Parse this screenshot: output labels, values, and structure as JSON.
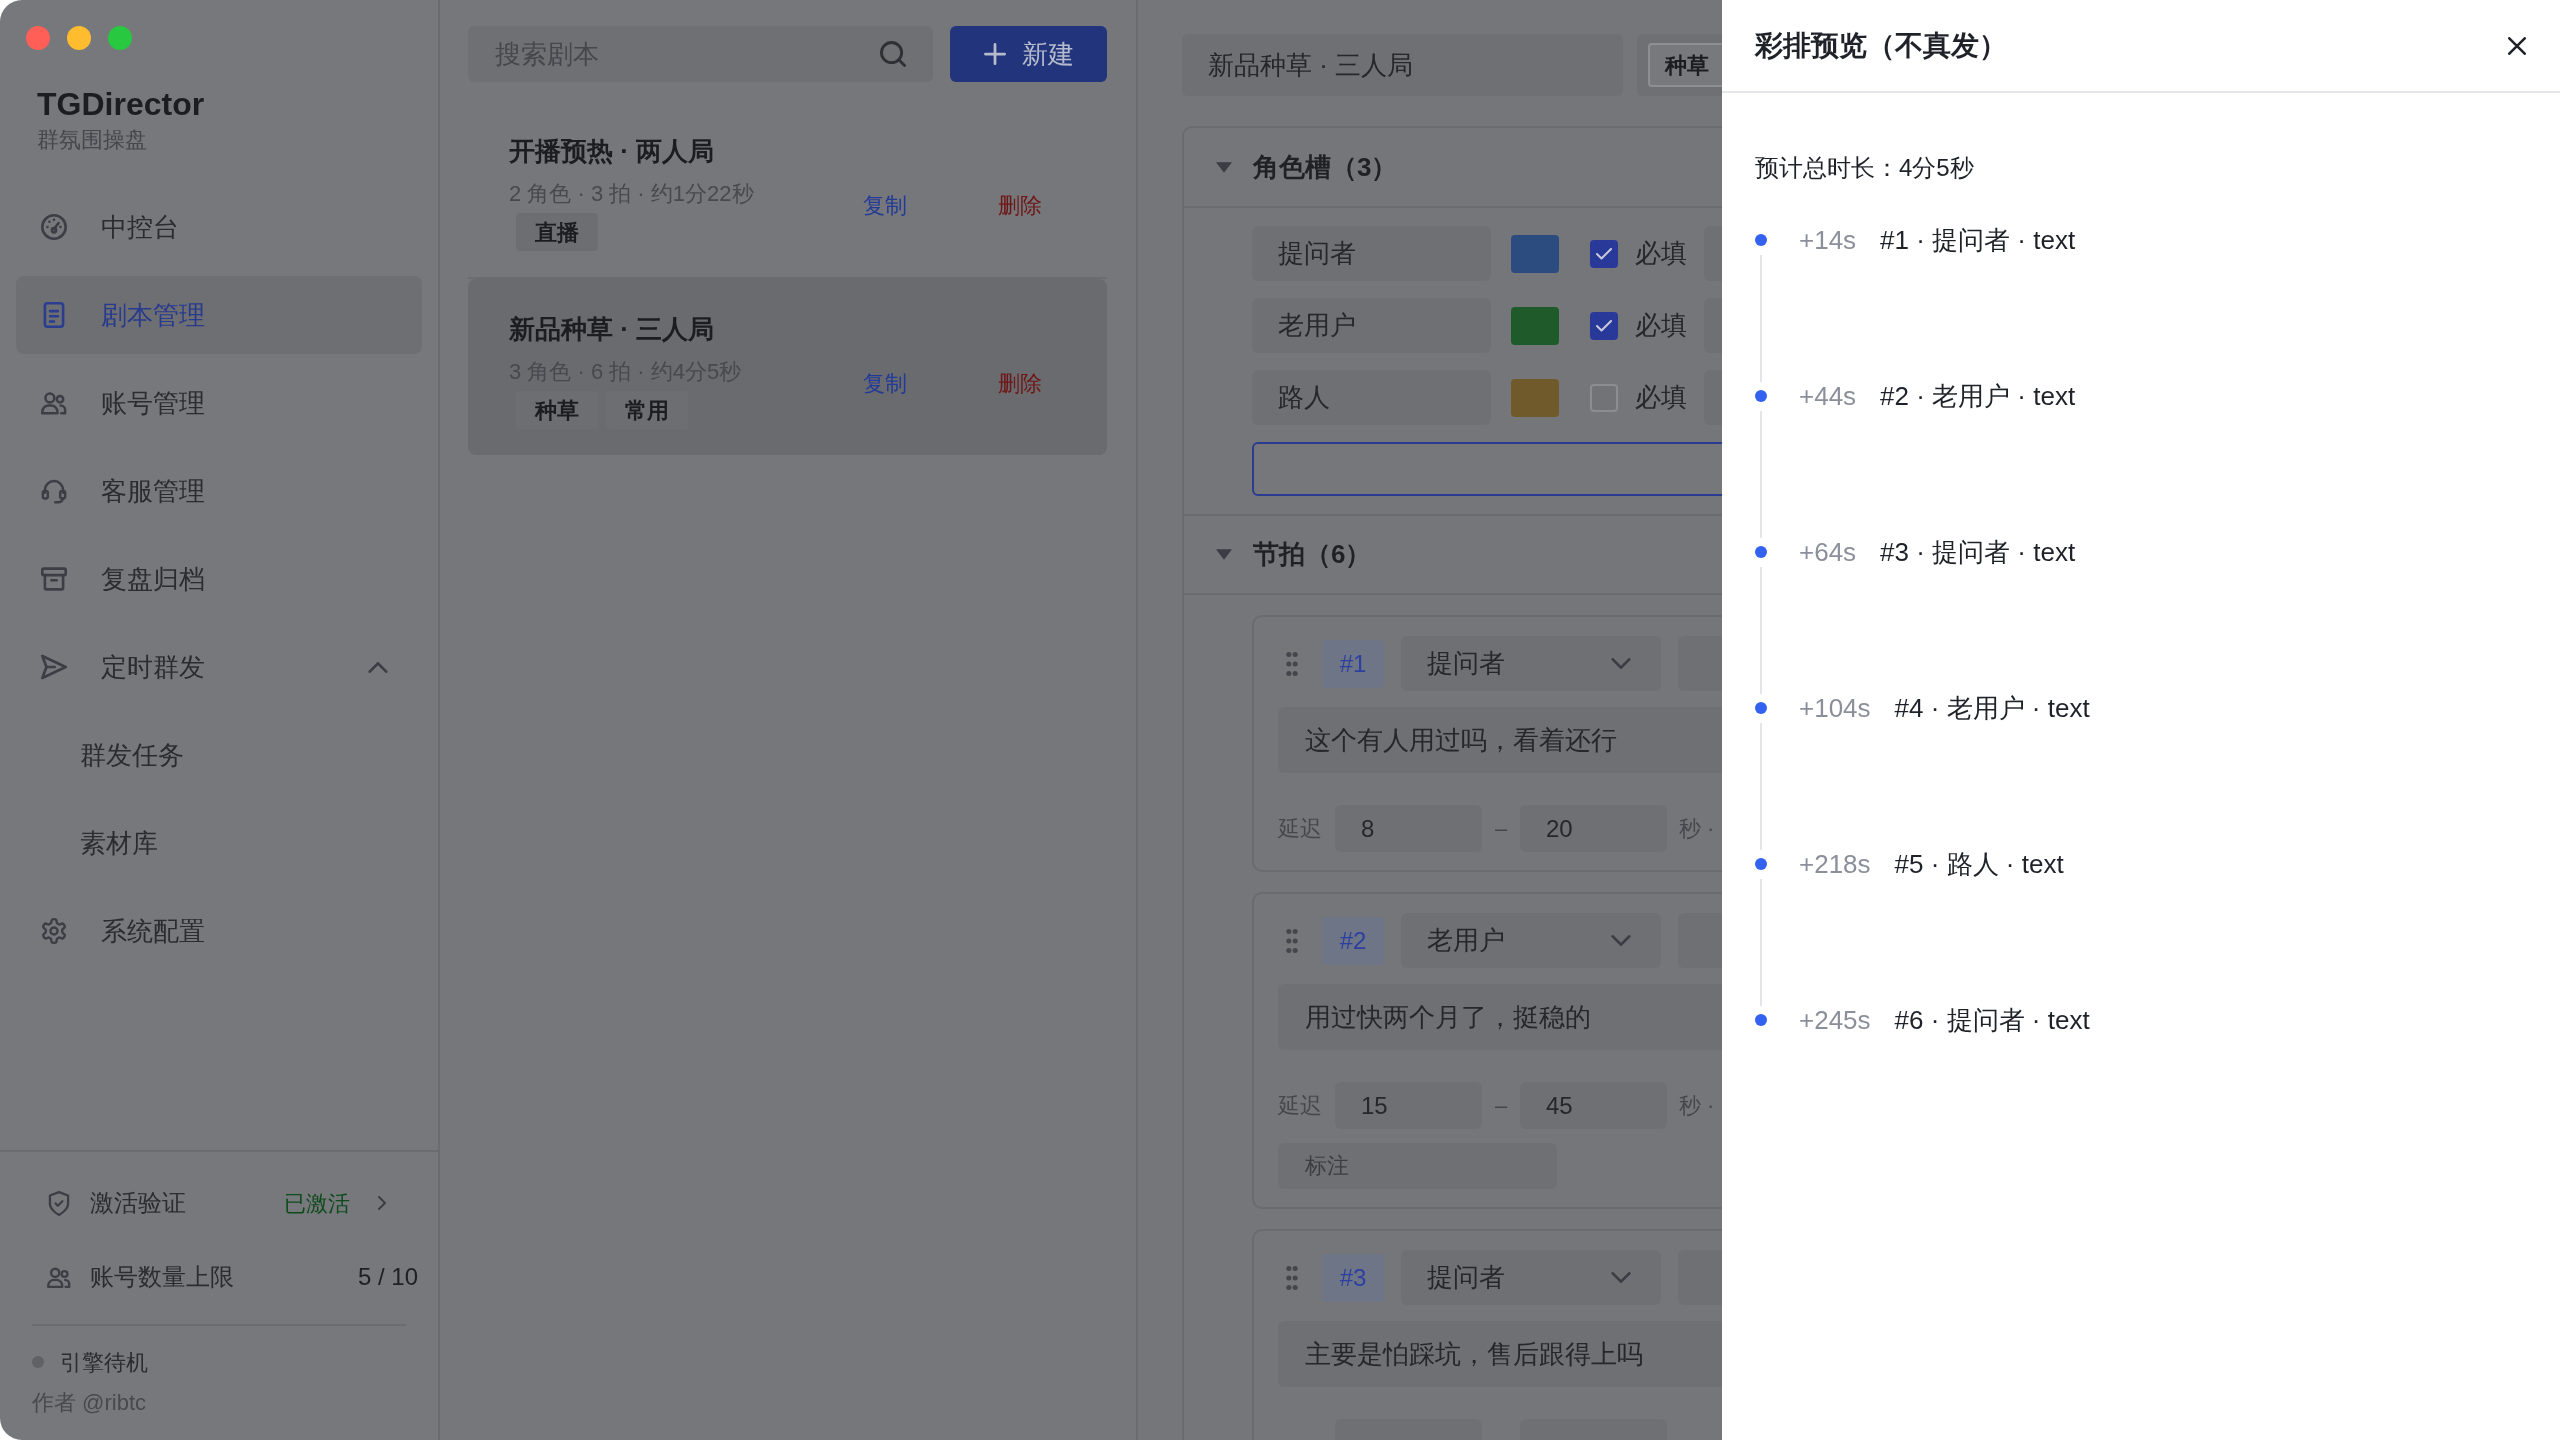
{
  "sidebar": {
    "brand": {
      "title": "TGDirector",
      "subtitle": "群氛围操盘"
    },
    "nav": [
      {
        "label": "中控台",
        "selected": false
      },
      {
        "label": "剧本管理",
        "selected": true
      },
      {
        "label": "账号管理",
        "selected": false
      },
      {
        "label": "客服管理",
        "selected": false
      },
      {
        "label": "复盘归档",
        "selected": false
      },
      {
        "label": "定时群发",
        "selected": false,
        "expanded": true,
        "children": [
          {
            "label": "群发任务",
            "selected": false
          },
          {
            "label": "素材库",
            "selected": false
          }
        ]
      },
      {
        "label": "系统配置",
        "selected": false
      }
    ],
    "activation": {
      "label": "激活验证",
      "status": "已激活"
    },
    "account_limit": {
      "label": "账号数量上限",
      "value": "5 / 10"
    },
    "engine": {
      "label": "引擎待机",
      "running": false
    },
    "author": "作者 @ribtc"
  },
  "script_list": {
    "search": {
      "placeholder": "搜索剧本"
    },
    "new_button": {
      "label": "新建"
    },
    "scripts": [
      {
        "title": "开播预热 · 两人局",
        "meta": "2 角色 · 3 拍 · 约1分22秒",
        "tags": [
          "直播"
        ],
        "selected": false,
        "actions": [
          {
            "label": "复制",
            "kind": "copy"
          },
          {
            "label": "删除",
            "kind": "delete"
          }
        ]
      },
      {
        "title": "新品种草 · 三人局",
        "meta": "3 角色 · 6 拍 · 约4分5秒",
        "tags": [
          "种草",
          "常用"
        ],
        "selected": true,
        "actions": [
          {
            "label": "复制",
            "kind": "copy"
          },
          {
            "label": "删除",
            "kind": "delete"
          }
        ]
      }
    ]
  },
  "editor": {
    "title_field": {
      "value": "新品种草 · 三人局"
    },
    "tags": [
      "种草"
    ],
    "roles_section": {
      "title": "角色槽（3）",
      "expanded": true,
      "roles": [
        {
          "name": "提问者",
          "color": "#2c4c80",
          "required": true,
          "required_label": "必填"
        },
        {
          "name": "老用户",
          "color": "#1f5a2b",
          "required": true,
          "required_label": "必填"
        },
        {
          "name": "路人",
          "color": "#705a2c",
          "required": false,
          "required_label": "必填"
        }
      ],
      "new_role_field": {
        "focused": true
      }
    },
    "beats_section": {
      "title": "节拍（6）",
      "expanded": true,
      "beats": [
        {
          "number": "#1",
          "role": "提问者",
          "text": "这个有人用过吗，看着还行",
          "delay_label": "延迟",
          "delay_min": "8",
          "separator": "–",
          "delay_max": "20",
          "unit": "秒 ·"
        },
        {
          "number": "#2",
          "role": "老用户",
          "text": "用过快两个月了，挺稳的",
          "delay_label": "延迟",
          "delay_min": "15",
          "separator": "–",
          "delay_max": "45",
          "unit": "秒 ·",
          "note": {
            "placeholder": "标注"
          }
        },
        {
          "number": "#3",
          "role": "提问者",
          "text": "主要是怕踩坑，售后跟得上吗"
        }
      ]
    }
  },
  "preview_drawer": {
    "title": "彩排预览（不真发）",
    "summary": "预计总时长：4分5秒",
    "timeline": [
      {
        "offset": "+14s",
        "label": "#1 · 提问者 · text"
      },
      {
        "offset": "+44s",
        "label": "#2 · 老用户 · text"
      },
      {
        "offset": "+64s",
        "label": "#3 · 提问者 · text"
      },
      {
        "offset": "+104s",
        "label": "#4 · 老用户 · text"
      },
      {
        "offset": "+218s",
        "label": "#5 · 路人 · text"
      },
      {
        "offset": "+245s",
        "label": "#6 · 提问者 · text"
      }
    ]
  }
}
